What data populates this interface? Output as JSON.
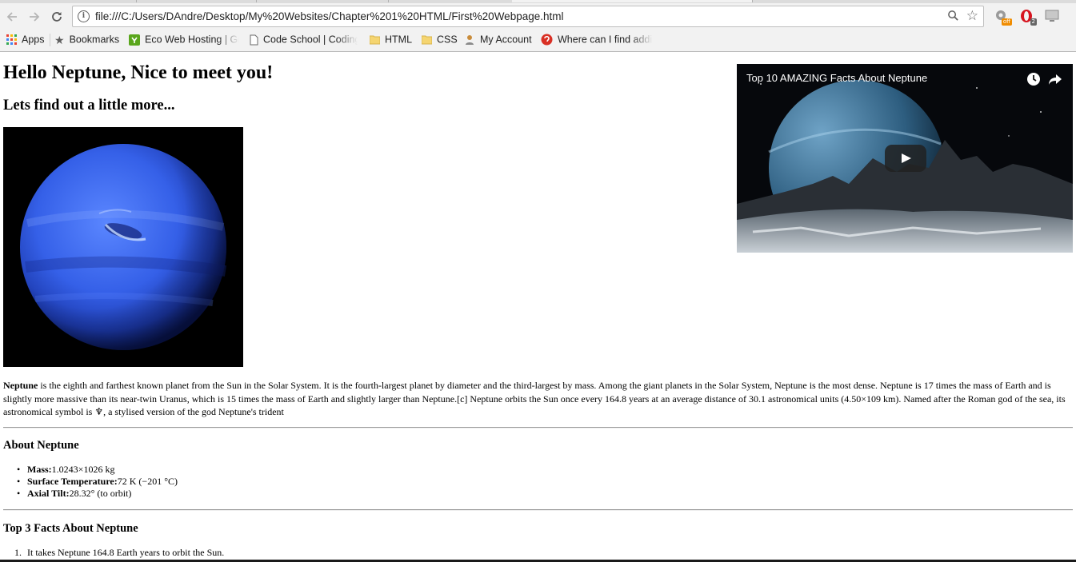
{
  "browser": {
    "url": "file:///C:/Users/DAndre/Desktop/My%20Websites/Chapter%201%20HTML/First%20Webpage.html",
    "extensions": [
      {
        "name": "extension-off",
        "badge": "off",
        "badge_color": "#f08c00"
      },
      {
        "name": "opera-extension",
        "badge": "2",
        "badge_color": "#666666"
      },
      {
        "name": "display-extension",
        "badge": "",
        "badge_color": ""
      }
    ],
    "bookmarks": [
      {
        "label": "Apps",
        "icon": "apps-grid-icon"
      },
      {
        "label": "Bookmarks",
        "icon": "star-icon"
      },
      {
        "label": "Eco Web Hosting | Gre",
        "icon": "eco-hosting-icon"
      },
      {
        "label": "Code School | Coding",
        "icon": "page-icon"
      },
      {
        "label": "HTML",
        "icon": "folder-icon"
      },
      {
        "label": "CSS",
        "icon": "folder-icon"
      },
      {
        "label": "My Account",
        "icon": "account-icon"
      },
      {
        "label": "Where can I find addi",
        "icon": "answers-icon"
      }
    ]
  },
  "page": {
    "heading": "Hello Neptune, Nice to meet you!",
    "subheading": "Lets find out a little more...",
    "video": {
      "title": "Top 10 AMAZING Facts About Neptune"
    },
    "intro": {
      "bold": "Neptune",
      "text": " is the eighth and farthest known planet from the Sun in the Solar System. It is the fourth-largest planet by diameter and the third-largest by mass. Among the giant planets in the Solar System, Neptune is the most dense. Neptune is 17 times the mass of Earth and is slightly more massive than its near-twin Uranus, which is 15 times the mass of Earth and slightly larger than Neptune.[c] Neptune orbits the Sun once every 164.8 years at an average distance of 30.1 astronomical units (4.50×109 km). Named after the Roman god of the sea, its astronomical symbol is ♆, a stylised version of the god Neptune's trident"
    },
    "about": {
      "title": "About Neptune",
      "items": [
        {
          "label": "Mass:",
          "value": "1.0243×1026 kg"
        },
        {
          "label": "Surface Temperature:",
          "value": "72 K (−201 °C)"
        },
        {
          "label": "Axial Tilt:",
          "value": "28.32° (to orbit)"
        }
      ]
    },
    "facts": {
      "title": "Top 3 Facts About Neptune",
      "items": [
        {
          "num": "1.",
          "text": "It takes Neptune 164.8 Earth years to orbit the Sun."
        }
      ]
    }
  }
}
